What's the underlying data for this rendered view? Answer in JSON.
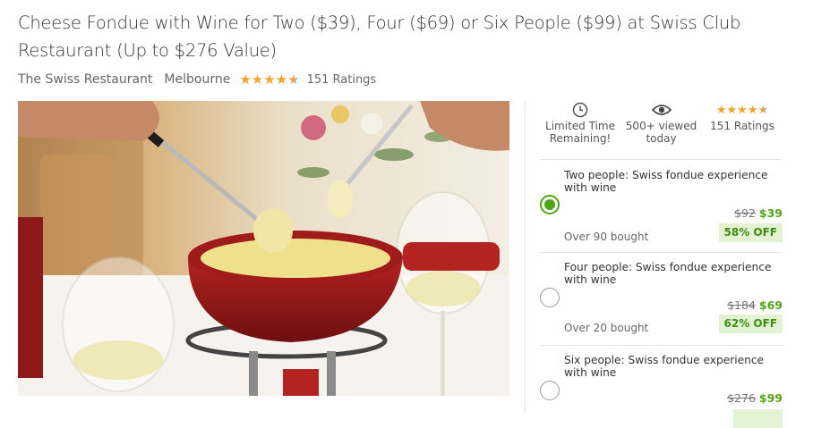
{
  "deal": {
    "title": "Cheese Fondue with Wine for Two ($39), Four ($69) or Six People ($99) at Swiss Club Restaurant (Up to $276 Value)",
    "merchant": "The Swiss Restaurant",
    "location": "Melbourne",
    "rating": 4.5,
    "ratings_label": "151 Ratings"
  },
  "hero_image": {
    "icon": "fondue-photo"
  },
  "info": {
    "time": {
      "icon": "clock-icon",
      "line1": "Limited Time",
      "line2": "Remaining!"
    },
    "views": {
      "icon": "eye-icon",
      "line1": "500+ viewed",
      "line2": "today"
    },
    "ratings": {
      "rating": 4.5,
      "label": "151 Ratings"
    }
  },
  "options": [
    {
      "title": "Two people: Swiss fondue experience with wine",
      "old_price": "$92",
      "new_price": "$39",
      "bought": "Over 90 bought",
      "discount": "58% OFF",
      "selected": true
    },
    {
      "title": "Four people: Swiss fondue experience with wine",
      "old_price": "$184",
      "new_price": "$69",
      "bought": "Over 20 bought",
      "discount": "62% OFF",
      "selected": false
    },
    {
      "title": "Six people: Swiss fondue experience with wine",
      "old_price": "$276",
      "new_price": "$99",
      "selected": false
    }
  ],
  "colors": {
    "accent_green": "#53a318",
    "discount_bg": "#e2f3d4",
    "star": "#f4a22d"
  }
}
